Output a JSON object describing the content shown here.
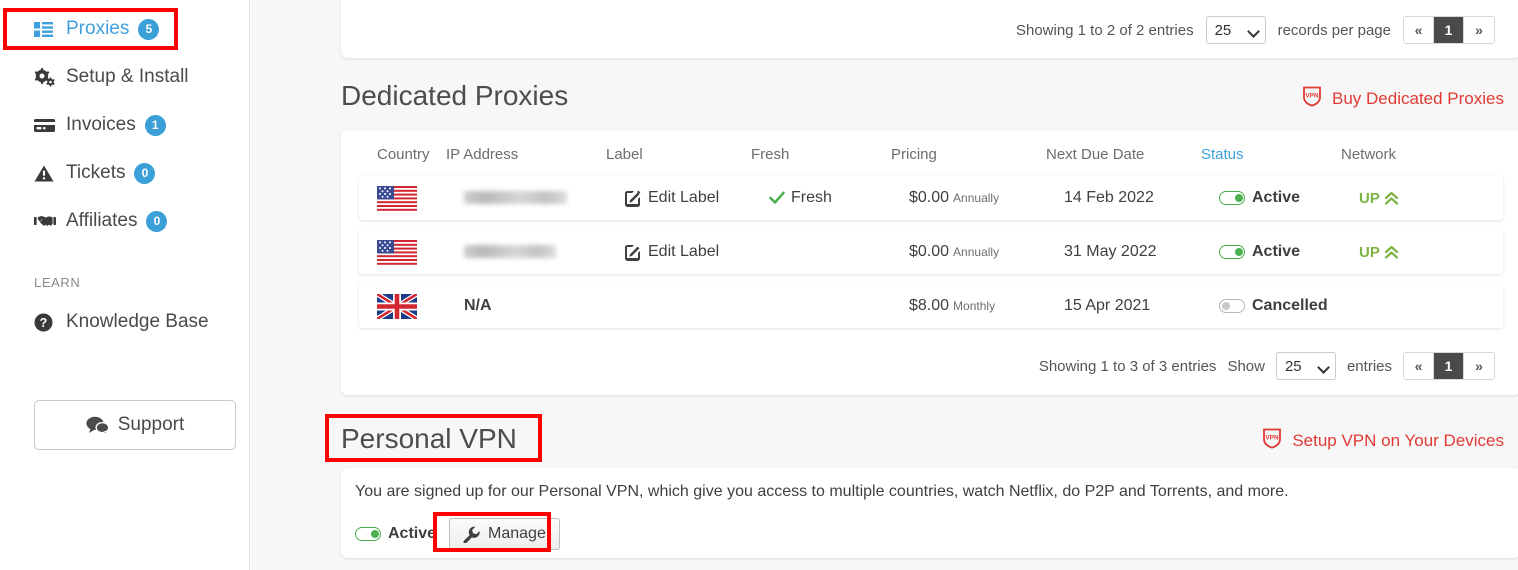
{
  "sidebar": {
    "items": [
      {
        "label": "Proxies",
        "badge": "5",
        "icon": "grid-icon",
        "active": true
      },
      {
        "label": "Setup & Install",
        "badge": null,
        "icon": "gears-icon",
        "active": false
      },
      {
        "label": "Invoices",
        "badge": "1",
        "icon": "credit-card-icon",
        "active": false
      },
      {
        "label": "Tickets",
        "badge": "0",
        "icon": "warning-icon",
        "active": false
      },
      {
        "label": "Affiliates",
        "badge": "0",
        "icon": "handshake-icon",
        "active": false
      }
    ],
    "learn_heading": "LEARN",
    "knowledge_base": {
      "label": "Knowledge Base",
      "icon": "question-circle-icon"
    },
    "support_button": {
      "label": "Support",
      "icon": "comments-icon"
    },
    "accent_color": "#3fa0de",
    "badge_color": "#3b9fd8"
  },
  "top_pager": {
    "showing": "Showing 1 to 2 of 2 entries",
    "per_page_value": "25",
    "per_page_options": [
      "25"
    ],
    "per_page_label": "records per page",
    "first_label": "«",
    "page_label": "1",
    "last_label": "»"
  },
  "dedicated": {
    "title": "Dedicated Proxies",
    "buy_link": "Buy Dedicated Proxies",
    "buy_link_icon": "vpn-shield-icon",
    "link_color": "#e03a35",
    "columns": [
      "Country",
      "IP Address",
      "Label",
      "Fresh",
      "Pricing",
      "Next Due Date",
      "Status",
      "Network"
    ],
    "status_column_color": "#3fa0de",
    "rows": [
      {
        "country": "US",
        "flag": "us-flag-icon",
        "ip": "",
        "ip_redacted": true,
        "label_action": "Edit Label",
        "label_icon": "edit-icon",
        "fresh": "Fresh",
        "fresh_icon": "check-icon",
        "price": "$0.00",
        "cycle": "Annually",
        "due": "14 Feb 2022",
        "status": "Active",
        "status_on": true,
        "network": "UP",
        "network_icon": "chevron-double-up-icon"
      },
      {
        "country": "US",
        "flag": "us-flag-icon",
        "ip": "",
        "ip_redacted": true,
        "label_action": "Edit Label",
        "label_icon": "edit-icon",
        "fresh": "",
        "fresh_icon": null,
        "price": "$0.00",
        "cycle": "Annually",
        "due": "31 May 2022",
        "status": "Active",
        "status_on": true,
        "network": "UP",
        "network_icon": "chevron-double-up-icon"
      },
      {
        "country": "GB",
        "flag": "uk-flag-icon",
        "ip": "N/A",
        "ip_redacted": false,
        "label_action": "",
        "label_icon": null,
        "fresh": "",
        "fresh_icon": null,
        "price": "$8.00",
        "cycle": "Monthly",
        "due": "15 Apr 2021",
        "status": "Cancelled",
        "status_on": false,
        "network": "",
        "network_icon": null
      }
    ],
    "pager": {
      "showing": "Showing 1 to 3 of 3 entries",
      "show_label": "Show",
      "per_page_value": "25",
      "per_page_options": [
        "25"
      ],
      "entries_label": "entries",
      "first_label": "«",
      "page_label": "1",
      "last_label": "»"
    }
  },
  "vpn": {
    "title": "Personal VPN",
    "setup_link": "Setup VPN on Your Devices",
    "setup_link_icon": "vpn-shield-icon",
    "description": "You are signed up for our Personal VPN, which give you access to multiple countries, watch Netflix, do P2P and Torrents, and more.",
    "status": "Active",
    "status_on": true,
    "manage_label": "Manage",
    "manage_icon": "wrench-icon"
  },
  "annotations": {
    "color": "#ff0000",
    "boxes": [
      "proxies-nav-item",
      "personal-vpn-heading",
      "manage-button"
    ]
  }
}
